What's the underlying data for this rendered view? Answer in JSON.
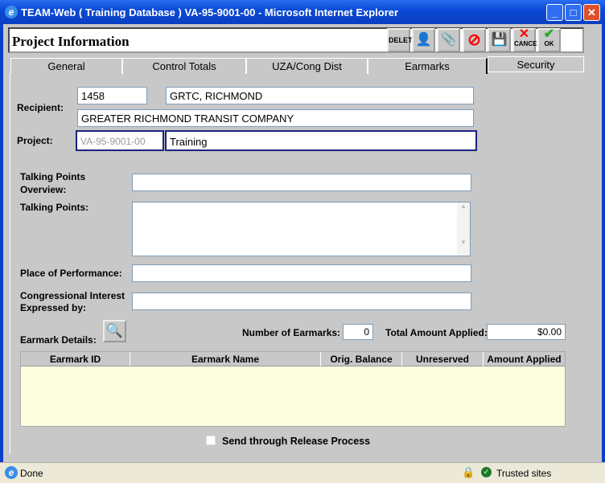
{
  "window": {
    "title": "TEAM-Web ( Training Database ) VA-95-9001-00 - Microsoft Internet Explorer"
  },
  "header": {
    "title": "Project Information",
    "buttons": {
      "delete": "DELETE",
      "cancel": "CANCEL",
      "ok": "OK"
    }
  },
  "tabs": [
    "General",
    "Control Totals",
    "UZA/Cong Dist",
    "Earmarks",
    "Security"
  ],
  "form": {
    "recipient_label": "Recipient:",
    "recipient_id": "1458",
    "recipient_short": "GRTC, RICHMOND",
    "recipient_name": "GREATER RICHMOND TRANSIT COMPANY",
    "project_label": "Project:",
    "project_id": "VA-95-9001-00",
    "project_name": "Training",
    "tp_overview_label": "Talking Points Overview:",
    "tp_label": "Talking Points:",
    "place_label": "Place of Performance:",
    "congress_label": "Congressional Interest Expressed by:",
    "earmark_details_label": "Earmark Details:",
    "num_earmarks_label": "Number of Earmarks:",
    "num_earmarks": "0",
    "total_label": "Total Amount Applied:",
    "total": "$0.00"
  },
  "grid": {
    "columns": [
      "Earmark ID",
      "Earmark Name",
      "Orig. Balance",
      "Unreserved",
      "Amount Applied"
    ]
  },
  "release": {
    "label": "Send through Release Process"
  },
  "status": {
    "text": "Done",
    "zone": "Trusted sites"
  }
}
